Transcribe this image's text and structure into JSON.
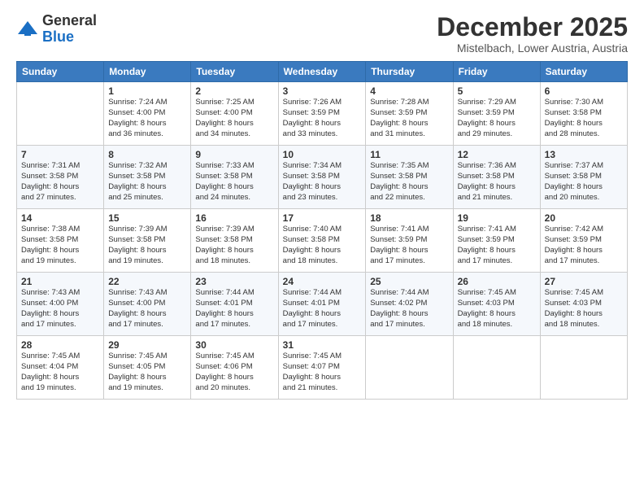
{
  "logo": {
    "general": "General",
    "blue": "Blue"
  },
  "header": {
    "month_year": "December 2025",
    "location": "Mistelbach, Lower Austria, Austria"
  },
  "weekdays": [
    "Sunday",
    "Monday",
    "Tuesday",
    "Wednesday",
    "Thursday",
    "Friday",
    "Saturday"
  ],
  "weeks": [
    [
      {
        "day": "",
        "info": ""
      },
      {
        "day": "1",
        "info": "Sunrise: 7:24 AM\nSunset: 4:00 PM\nDaylight: 8 hours\nand 36 minutes."
      },
      {
        "day": "2",
        "info": "Sunrise: 7:25 AM\nSunset: 4:00 PM\nDaylight: 8 hours\nand 34 minutes."
      },
      {
        "day": "3",
        "info": "Sunrise: 7:26 AM\nSunset: 3:59 PM\nDaylight: 8 hours\nand 33 minutes."
      },
      {
        "day": "4",
        "info": "Sunrise: 7:28 AM\nSunset: 3:59 PM\nDaylight: 8 hours\nand 31 minutes."
      },
      {
        "day": "5",
        "info": "Sunrise: 7:29 AM\nSunset: 3:59 PM\nDaylight: 8 hours\nand 29 minutes."
      },
      {
        "day": "6",
        "info": "Sunrise: 7:30 AM\nSunset: 3:58 PM\nDaylight: 8 hours\nand 28 minutes."
      }
    ],
    [
      {
        "day": "7",
        "info": "Sunrise: 7:31 AM\nSunset: 3:58 PM\nDaylight: 8 hours\nand 27 minutes."
      },
      {
        "day": "8",
        "info": "Sunrise: 7:32 AM\nSunset: 3:58 PM\nDaylight: 8 hours\nand 25 minutes."
      },
      {
        "day": "9",
        "info": "Sunrise: 7:33 AM\nSunset: 3:58 PM\nDaylight: 8 hours\nand 24 minutes."
      },
      {
        "day": "10",
        "info": "Sunrise: 7:34 AM\nSunset: 3:58 PM\nDaylight: 8 hours\nand 23 minutes."
      },
      {
        "day": "11",
        "info": "Sunrise: 7:35 AM\nSunset: 3:58 PM\nDaylight: 8 hours\nand 22 minutes."
      },
      {
        "day": "12",
        "info": "Sunrise: 7:36 AM\nSunset: 3:58 PM\nDaylight: 8 hours\nand 21 minutes."
      },
      {
        "day": "13",
        "info": "Sunrise: 7:37 AM\nSunset: 3:58 PM\nDaylight: 8 hours\nand 20 minutes."
      }
    ],
    [
      {
        "day": "14",
        "info": "Sunrise: 7:38 AM\nSunset: 3:58 PM\nDaylight: 8 hours\nand 19 minutes."
      },
      {
        "day": "15",
        "info": "Sunrise: 7:39 AM\nSunset: 3:58 PM\nDaylight: 8 hours\nand 19 minutes."
      },
      {
        "day": "16",
        "info": "Sunrise: 7:39 AM\nSunset: 3:58 PM\nDaylight: 8 hours\nand 18 minutes."
      },
      {
        "day": "17",
        "info": "Sunrise: 7:40 AM\nSunset: 3:58 PM\nDaylight: 8 hours\nand 18 minutes."
      },
      {
        "day": "18",
        "info": "Sunrise: 7:41 AM\nSunset: 3:59 PM\nDaylight: 8 hours\nand 17 minutes."
      },
      {
        "day": "19",
        "info": "Sunrise: 7:41 AM\nSunset: 3:59 PM\nDaylight: 8 hours\nand 17 minutes."
      },
      {
        "day": "20",
        "info": "Sunrise: 7:42 AM\nSunset: 3:59 PM\nDaylight: 8 hours\nand 17 minutes."
      }
    ],
    [
      {
        "day": "21",
        "info": "Sunrise: 7:43 AM\nSunset: 4:00 PM\nDaylight: 8 hours\nand 17 minutes."
      },
      {
        "day": "22",
        "info": "Sunrise: 7:43 AM\nSunset: 4:00 PM\nDaylight: 8 hours\nand 17 minutes."
      },
      {
        "day": "23",
        "info": "Sunrise: 7:44 AM\nSunset: 4:01 PM\nDaylight: 8 hours\nand 17 minutes."
      },
      {
        "day": "24",
        "info": "Sunrise: 7:44 AM\nSunset: 4:01 PM\nDaylight: 8 hours\nand 17 minutes."
      },
      {
        "day": "25",
        "info": "Sunrise: 7:44 AM\nSunset: 4:02 PM\nDaylight: 8 hours\nand 17 minutes."
      },
      {
        "day": "26",
        "info": "Sunrise: 7:45 AM\nSunset: 4:03 PM\nDaylight: 8 hours\nand 18 minutes."
      },
      {
        "day": "27",
        "info": "Sunrise: 7:45 AM\nSunset: 4:03 PM\nDaylight: 8 hours\nand 18 minutes."
      }
    ],
    [
      {
        "day": "28",
        "info": "Sunrise: 7:45 AM\nSunset: 4:04 PM\nDaylight: 8 hours\nand 19 minutes."
      },
      {
        "day": "29",
        "info": "Sunrise: 7:45 AM\nSunset: 4:05 PM\nDaylight: 8 hours\nand 19 minutes."
      },
      {
        "day": "30",
        "info": "Sunrise: 7:45 AM\nSunset: 4:06 PM\nDaylight: 8 hours\nand 20 minutes."
      },
      {
        "day": "31",
        "info": "Sunrise: 7:45 AM\nSunset: 4:07 PM\nDaylight: 8 hours\nand 21 minutes."
      },
      {
        "day": "",
        "info": ""
      },
      {
        "day": "",
        "info": ""
      },
      {
        "day": "",
        "info": ""
      }
    ]
  ]
}
